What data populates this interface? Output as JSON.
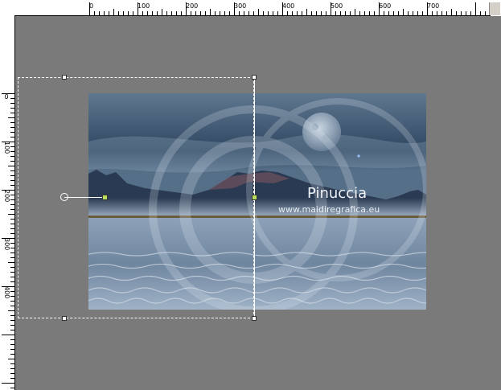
{
  "ruler": {
    "top_labels": [
      "0",
      "100",
      "200",
      "300",
      "400",
      "500",
      "600",
      "700"
    ],
    "left_labels": [
      "0",
      "100",
      "200",
      "300",
      "400"
    ]
  },
  "image": {
    "watermark_title": "Pinuccia",
    "watermark_url": "www.maidiregrafica.eu"
  },
  "colors": {
    "workspace": "#7a7a7a",
    "selection": "#ffffff",
    "handle_accent": "#b8e05a"
  }
}
